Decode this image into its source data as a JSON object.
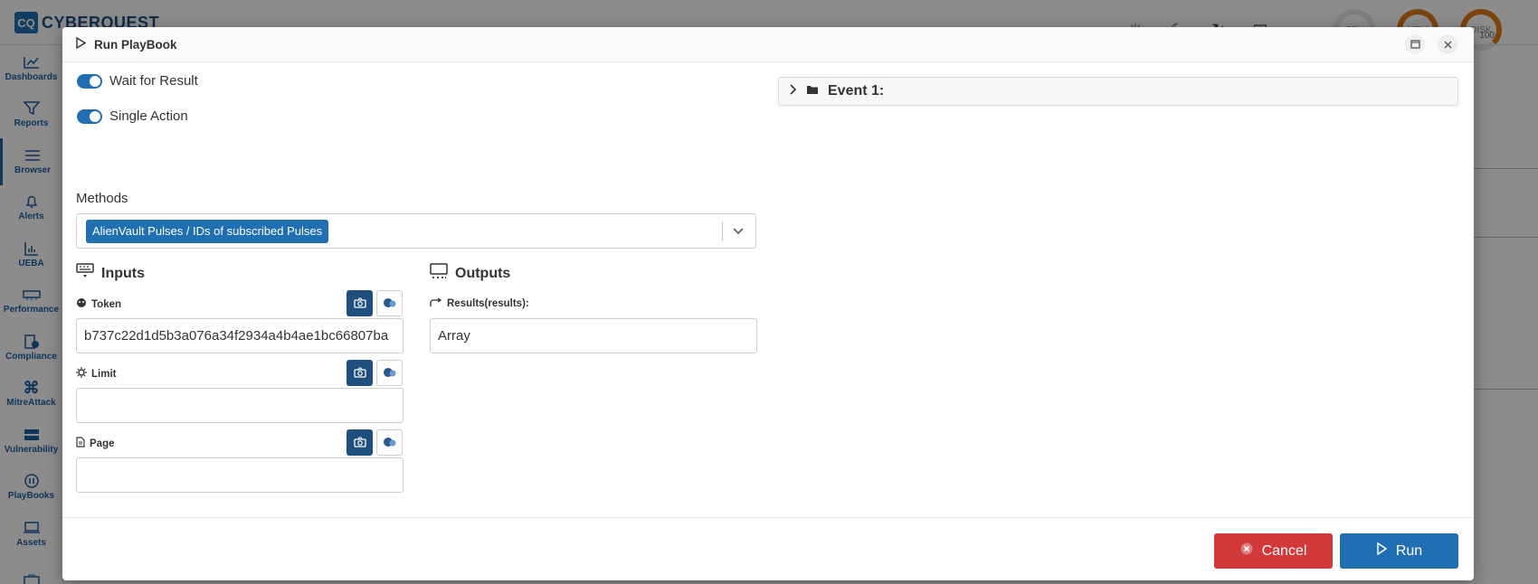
{
  "app": {
    "logo_abbr": "CQ",
    "logo_text": "CYBERQUEST",
    "gauges": [
      "CPU",
      "MEM",
      "DISK"
    ],
    "gauge_extra": "100",
    "sidebar": [
      {
        "label": "Dashboards"
      },
      {
        "label": "Reports"
      },
      {
        "label": "Browser"
      },
      {
        "label": "Alerts"
      },
      {
        "label": "UEBA"
      },
      {
        "label": "Performance"
      },
      {
        "label": "Compliance"
      },
      {
        "label": "MitreAttack"
      },
      {
        "label": "Vulnerability"
      },
      {
        "label": "PlayBooks"
      },
      {
        "label": "Assets"
      }
    ]
  },
  "modal": {
    "title": "Run PlayBook",
    "toggles": {
      "wait": "Wait for Result",
      "single": "Single Action"
    },
    "methods_label": "Methods",
    "method_chip": "AlienVault Pulses / IDs of subscribed Pulses",
    "inputs_title": "Inputs",
    "outputs_title": "Outputs",
    "fields": {
      "token_label": "Token",
      "token_value": "b737c22d1d5b3a076a34f2934a4b4ae1bc66807ba",
      "limit_label": "Limit",
      "limit_value": "",
      "page_label": "Page",
      "page_value": ""
    },
    "outputs": {
      "results_label": "Results(results):",
      "results_value": "Array"
    },
    "event_label": "Event 1:",
    "cancel": "Cancel",
    "run": "Run"
  }
}
